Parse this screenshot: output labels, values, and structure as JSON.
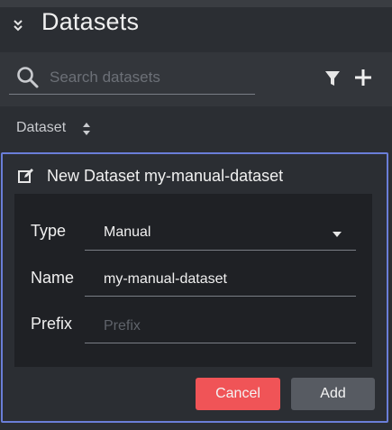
{
  "panel": {
    "title": "Datasets"
  },
  "search": {
    "placeholder": "Search datasets",
    "value": ""
  },
  "table": {
    "column_label": "Dataset"
  },
  "new_dataset": {
    "title": "New Dataset my-manual-dataset",
    "fields": {
      "type_label": "Type",
      "type_value": "Manual",
      "name_label": "Name",
      "name_value": "my-manual-dataset",
      "prefix_label": "Prefix",
      "prefix_placeholder": "Prefix",
      "prefix_value": ""
    },
    "buttons": {
      "cancel": "Cancel",
      "add": "Add"
    }
  },
  "colors": {
    "background": "#2b2e33",
    "accent_border": "#6a7ed8",
    "cancel_button": "#f05457",
    "add_button": "#575b62"
  },
  "icons": [
    "chevron-double-down-icon",
    "search-icon",
    "filter-icon",
    "plus-icon",
    "sort-icon",
    "edit-icon",
    "caret-down-icon"
  ]
}
